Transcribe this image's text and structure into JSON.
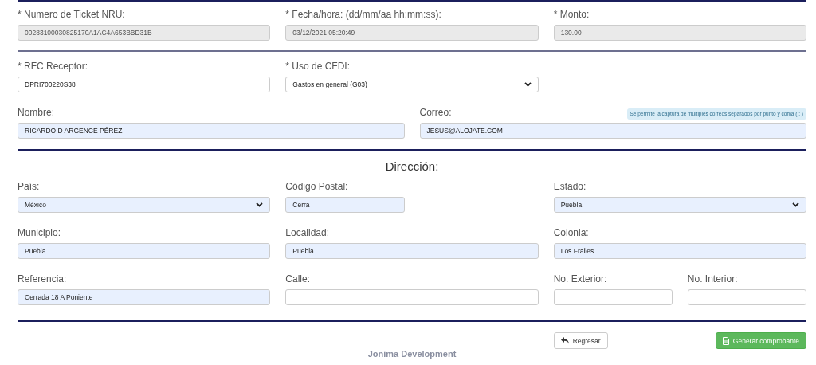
{
  "ticket": {
    "rows": [
      [
        {
          "label": "* Numero de Ticket NRU:",
          "value": "00283100030825170A1AC4A653BBD31B",
          "kind": "readonly",
          "autofilled": false
        },
        {
          "label": "* Fecha/hora: (dd/mm/aa hh:mm:ss):",
          "value": "03/12/2021 05:20:49",
          "kind": "readonly",
          "autofilled": false
        },
        {
          "label": "* Monto:",
          "value": "130.00",
          "kind": "readonly",
          "autofilled": false
        }
      ]
    ]
  },
  "receptor": {
    "rows": [
      [
        {
          "label": "* RFC Receptor:",
          "value": "DPRI700220S38",
          "kind": "input",
          "autofilled": false
        },
        {
          "label": "* Uso de CFDI:",
          "value": "Gastos en general (G03)",
          "kind": "select",
          "autofilled": false
        },
        {
          "kind": "empty"
        }
      ],
      [
        {
          "label": "Nombre:",
          "value": "RICARDO D ARGENCE PÉREZ",
          "kind": "input",
          "autofilled": true
        },
        {
          "label": "Correo:",
          "value": "JESUS@ALOJATE.COM",
          "kind": "input",
          "autofilled": true,
          "hint": "Se permite la captura de múltiples correos separados por punto y coma ( ; )"
        }
      ]
    ]
  },
  "direccion": {
    "title": "Dirección:",
    "rows": [
      [
        {
          "label": "País:",
          "value": "México",
          "kind": "select",
          "autofilled": true
        },
        {
          "label": "Código Postal:",
          "value": "Cerra",
          "kind": "short",
          "autofilled": true
        },
        {
          "label": "Estado:",
          "value": "Puebla",
          "kind": "select",
          "autofilled": true
        }
      ],
      [
        {
          "label": "Municipio:",
          "value": "Puebla",
          "kind": "input",
          "autofilled": true
        },
        {
          "label": "Localidad:",
          "value": "Puebla",
          "kind": "input",
          "autofilled": true
        },
        {
          "label": "Colonia:",
          "value": "Los Frailes",
          "kind": "input",
          "autofilled": true
        }
      ],
      [
        {
          "label": "Referencia:",
          "value": "Cerrada 18 A Poniente",
          "kind": "input",
          "autofilled": true
        },
        {
          "label": "Calle:",
          "kind": "input",
          "autofilled": false
        },
        {
          "label": "No. Exterior:",
          "kind": "input",
          "autofilled": false
        },
        {
          "label": "No. Interior:",
          "kind": "input",
          "autofilled": false
        }
      ]
    ]
  },
  "actions": [
    {
      "label": "Regresar",
      "kind": "back"
    },
    {
      "label": "Generar comprobante",
      "kind": "generate"
    }
  ],
  "footer": "Jonima Development"
}
